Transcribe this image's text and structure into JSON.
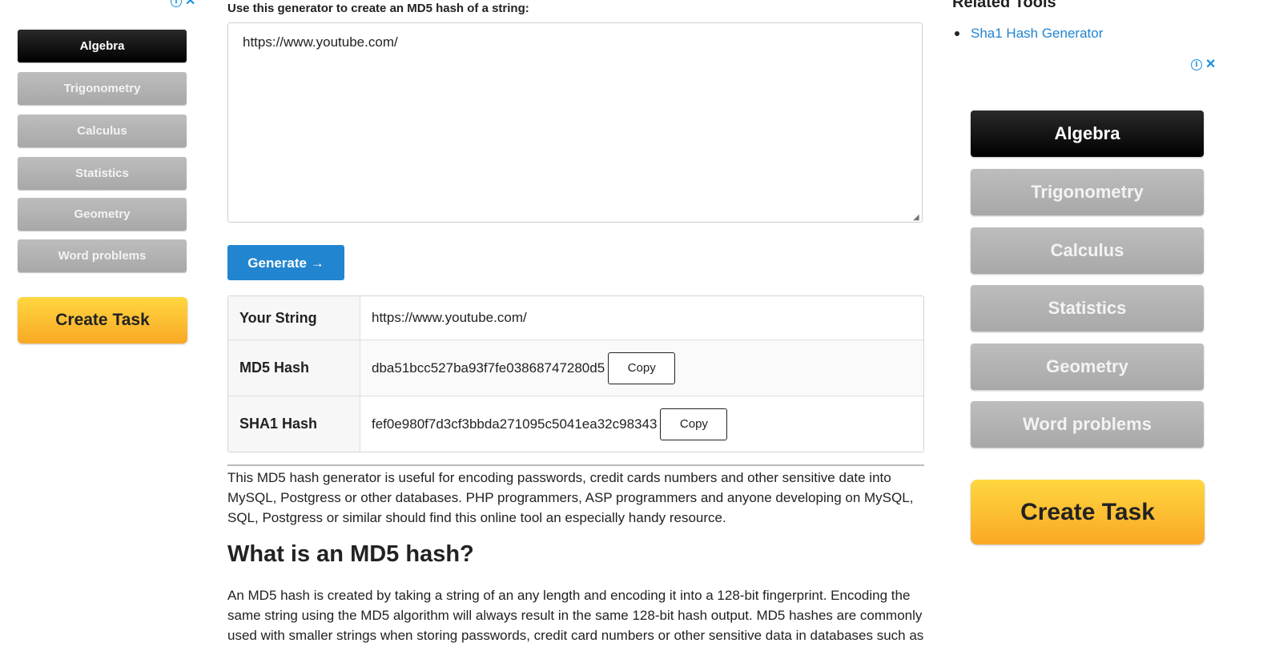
{
  "intro": {
    "label": "Use this generator to create an MD5 hash of a string:",
    "input_value": "https://www.youtube.com/"
  },
  "generate_label": "Generate →",
  "results": [
    {
      "label": "Your String",
      "value": "https://www.youtube.com/",
      "copy": ""
    },
    {
      "label": "MD5 Hash",
      "value": "dba51bcc527ba93f7fe03868747280d5",
      "copy": "Copy"
    },
    {
      "label": "SHA1 Hash",
      "value": "fef0e980f7d3cf3bbda271095c5041ea32c98343",
      "copy": "Copy"
    }
  ],
  "description": "This MD5 hash generator is useful for encoding passwords, credit cards numbers and other sensitive date into MySQL, Postgress or other databases. PHP programmers, ASP programmers and anyone developing on MySQL, SQL, Postgress or similar should find this online tool an especially handy resource.",
  "section": {
    "heading": "What is an MD5 hash?",
    "body": "An MD5 hash is created by taking a string of an any length and encoding it into a 128-bit fingerprint. Encoding the same string using the MD5 algorithm will always result in the same 128-bit hash output. MD5 hashes are commonly used with smaller strings when storing passwords, credit card numbers or other sensitive data in databases such as"
  },
  "related": {
    "title": "Related Tools",
    "items": [
      "Sha1 Hash Generator"
    ]
  },
  "ads": {
    "info_icon": "info-icon",
    "close_icon": "close-icon",
    "subjects": [
      "Algebra",
      "Trigonometry",
      "Calculus",
      "Statistics",
      "Geometry",
      "Word problems"
    ],
    "cta": "Create Task"
  },
  "colors": {
    "primary": "#2185d0",
    "cta_yellow": "#fbc02d"
  }
}
